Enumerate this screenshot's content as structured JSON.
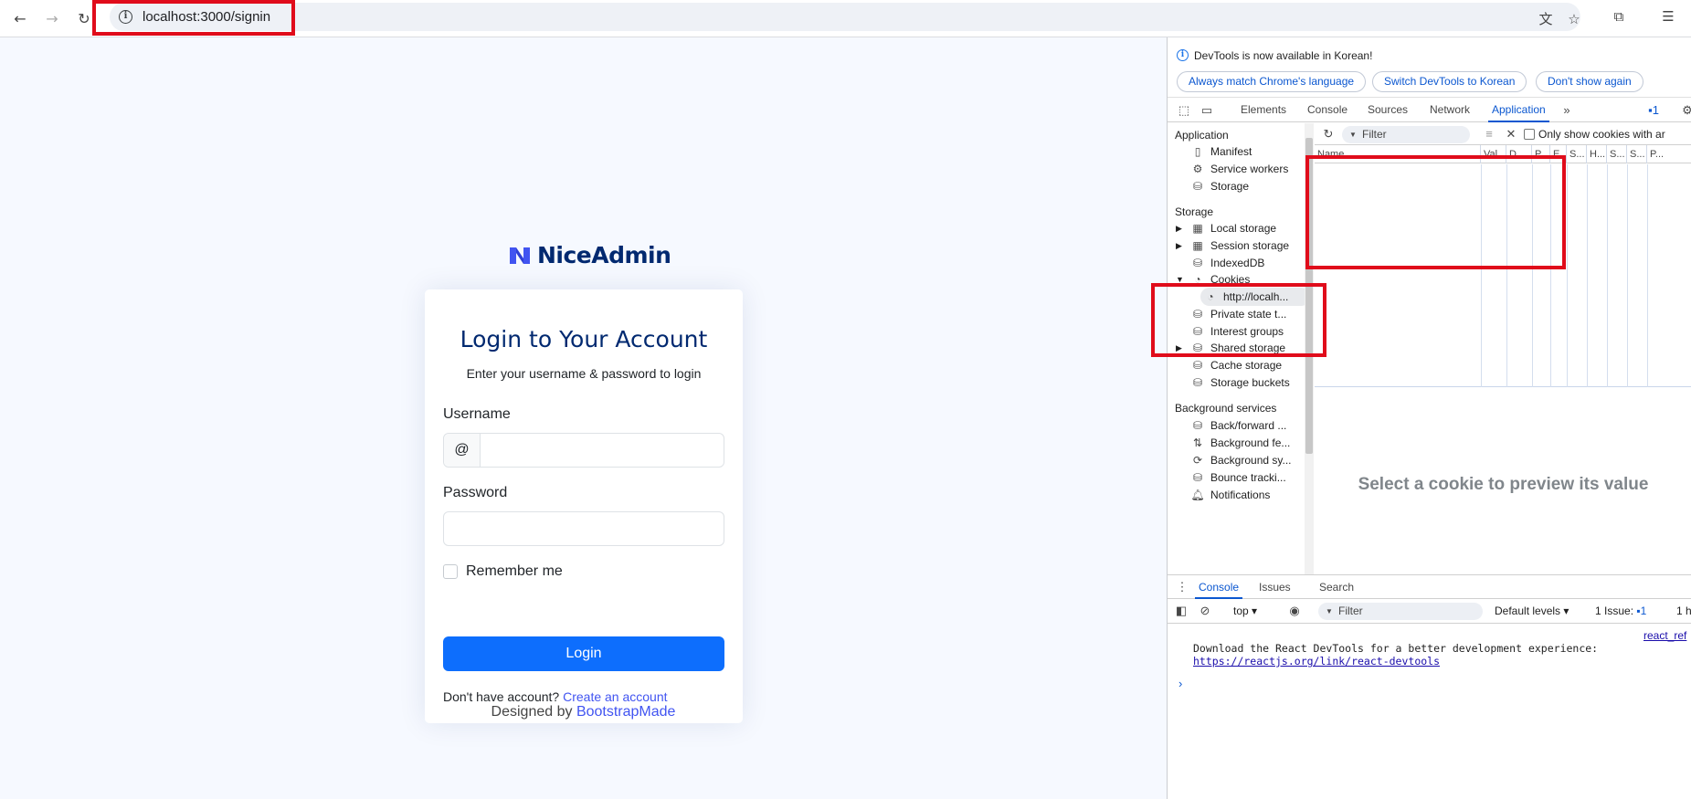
{
  "browser": {
    "url": "localhost:3000/signin"
  },
  "page": {
    "brand": "NiceAdmin",
    "title": "Login to Your Account",
    "subtitle": "Enter your username & password to login",
    "username_label": "Username",
    "username_addon": "@",
    "username_value": "",
    "password_label": "Password",
    "password_value": "",
    "remember_label": "Remember me",
    "login_button": "Login",
    "signup_text": "Don't have account?",
    "signup_link": "Create an account",
    "credits_text": "Designed by",
    "credits_link": "BootstrapMade",
    "colors": {
      "primary": "#0d6efd",
      "heading": "#012970",
      "link": "#4154f1",
      "background": "#f6f9ff"
    }
  },
  "devtools": {
    "notice": "DevTools is now available in Korean!",
    "notice_buttons": [
      "Always match Chrome's language",
      "Switch DevTools to Korean",
      "Don't show again"
    ],
    "tabs": [
      "Elements",
      "Console",
      "Sources",
      "Network",
      "Application"
    ],
    "active_tab": "Application",
    "issues_count": "1",
    "sidebar": {
      "application_heading": "Application",
      "application_items": [
        "Manifest",
        "Service workers",
        "Storage"
      ],
      "storage_heading": "Storage",
      "storage_items": [
        "Local storage",
        "Session storage",
        "IndexedDB",
        "Cookies",
        "http://localh...",
        "Private state t...",
        "Interest groups",
        "Shared storage",
        "Cache storage",
        "Storage buckets"
      ],
      "background_heading": "Background services",
      "background_items": [
        "Back/forward ...",
        "Background fe...",
        "Background sy...",
        "Bounce tracki...",
        "Notifications"
      ]
    },
    "cookies": {
      "filter_placeholder": "Filter",
      "only_show_label": "Only show cookies with ar",
      "columns": [
        "Name",
        "Val...",
        "D...",
        "P...",
        "E...",
        "S...",
        "H...",
        "S...",
        "S...",
        "P..."
      ],
      "preview_message": "Select a cookie to preview its value"
    },
    "drawer": {
      "tabs": [
        "Console",
        "Issues",
        "Search"
      ],
      "active_tab": "Console",
      "context": "top",
      "filter_placeholder": "Filter",
      "levels": "Default levels",
      "issues_label": "1 Issue:",
      "issues_count": "1",
      "hidden_count": "1 h",
      "message_line1": "Download the React DevTools for a better development experience:",
      "message_link": "https://reactjs.org/link/react-devtools",
      "message_source": "react_ref"
    }
  }
}
